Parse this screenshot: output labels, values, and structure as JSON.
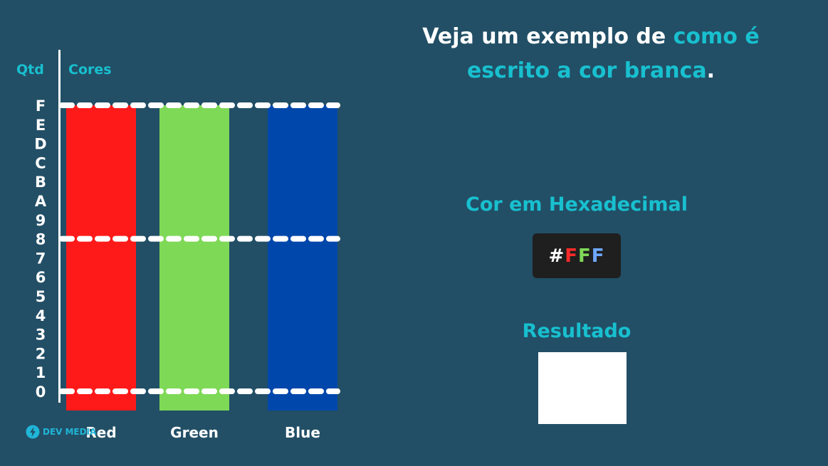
{
  "header": {
    "title_part1": "Veja um exemplo de ",
    "title_accent1": "como é",
    "title_accent2": "escrito a cor branca",
    "title_end": "."
  },
  "chart_data": {
    "type": "bar",
    "ylabel": "Qtd",
    "xlabel": "Cores",
    "y_ticks": [
      "0",
      "1",
      "2",
      "3",
      "4",
      "5",
      "6",
      "7",
      "8",
      "9",
      "A",
      "B",
      "C",
      "D",
      "E",
      "F"
    ],
    "ylim": [
      0,
      15
    ],
    "categories": [
      "Red",
      "Green",
      "Blue"
    ],
    "values": [
      15,
      15,
      15
    ],
    "colors": [
      "#ff1a1a",
      "#7ed957",
      "#0047ab"
    ],
    "reference_lines": [
      0,
      8,
      15
    ]
  },
  "hex": {
    "label": "Cor em Hexadecimal",
    "chars": [
      {
        "ch": "#",
        "color": "#ffffff"
      },
      {
        "ch": "F",
        "color": "#ff2a2a"
      },
      {
        "ch": "F",
        "color": "#7ed957"
      },
      {
        "ch": "F",
        "color": "#6fa8ff"
      }
    ]
  },
  "result": {
    "label": "Resultado",
    "color": "#ffffff"
  },
  "logo": {
    "text1": "DEV",
    "text2": "MEDIA",
    "icon": "devmedia-logo-icon",
    "color": "#20b6d8"
  }
}
